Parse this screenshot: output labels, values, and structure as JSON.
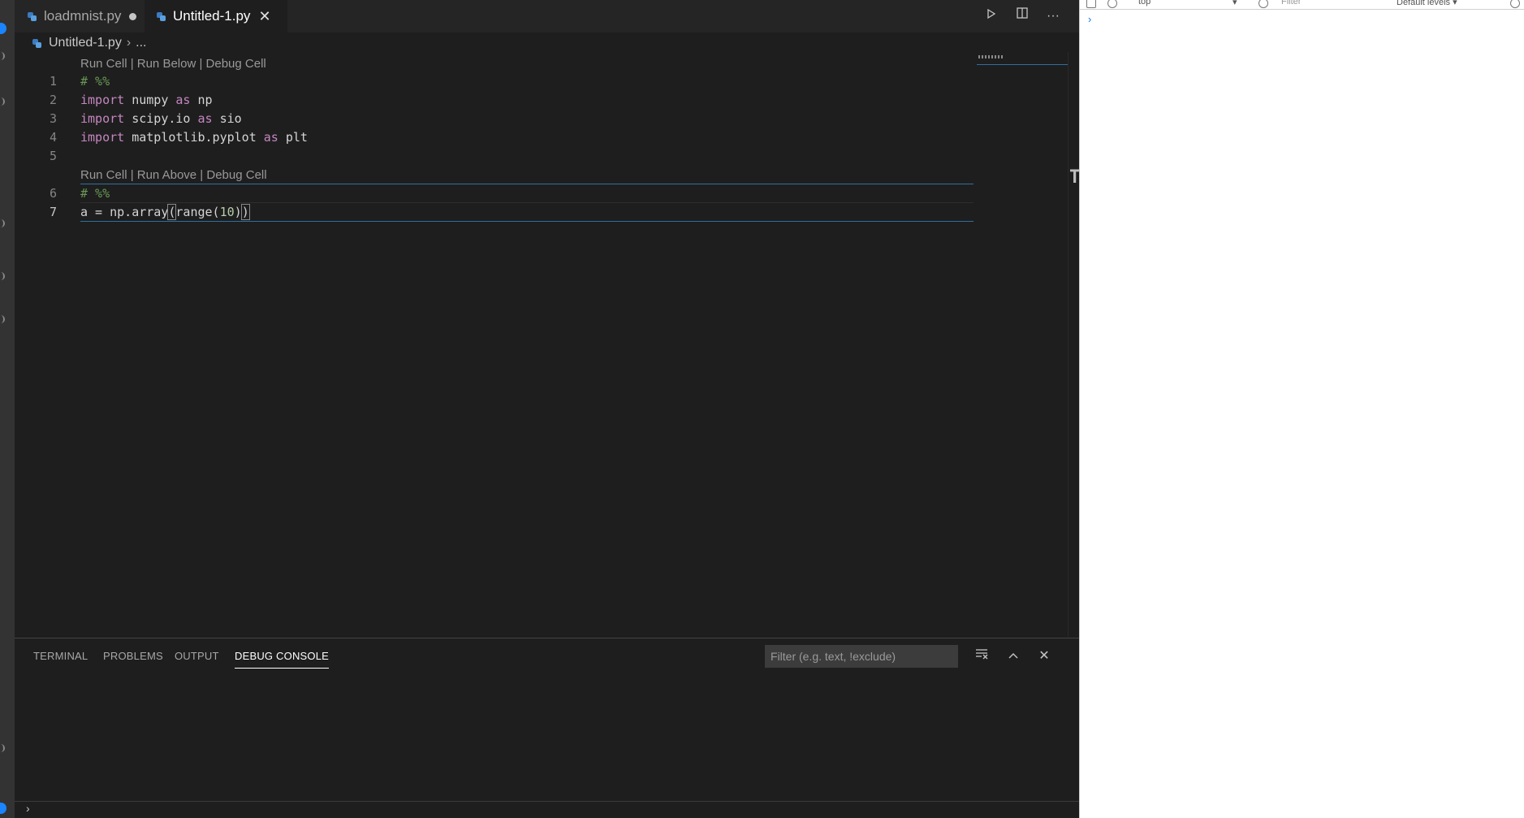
{
  "editor": {
    "tabs": [
      {
        "label": "loadmnist.py",
        "dirty": true,
        "active": false
      },
      {
        "label": "Untitled-1.py",
        "dirty": false,
        "active": true
      }
    ],
    "breadcrumb": {
      "file": "Untitled-1.py",
      "rest": "..."
    },
    "codelens": {
      "cell1": "Run Cell | Run Below | Debug Cell",
      "cell2": "Run Cell | Run Above | Debug Cell"
    },
    "lines": [
      {
        "n": "1",
        "text": "# %%"
      },
      {
        "n": "2",
        "text": "import numpy as np"
      },
      {
        "n": "3",
        "text": "import scipy.io as sio"
      },
      {
        "n": "4",
        "text": "import matplotlib.pyplot as plt"
      },
      {
        "n": "5",
        "text": ""
      },
      {
        "n": "6",
        "text": "# %%"
      },
      {
        "n": "7",
        "text": "a = np.array(range(10))"
      }
    ],
    "actions": {
      "run": "play-icon",
      "split": "split-editor-icon",
      "more": "more-icon"
    }
  },
  "panel": {
    "tabs": [
      "TERMINAL",
      "PROBLEMS",
      "OUTPUT",
      "DEBUG CONSOLE"
    ],
    "active_tab": "DEBUG CONSOLE",
    "filter_placeholder": "Filter (e.g. text, !exclude)"
  },
  "devtools": {
    "context": "top",
    "filter_placeholder": "Filter",
    "levels": "Default levels ▾",
    "prompt": "›"
  },
  "colors": {
    "editor_bg": "#1e1e1e",
    "keyword": "#c586c0",
    "comment": "#6a9955",
    "number": "#b5cea8",
    "accent": "#2f6f9f"
  }
}
